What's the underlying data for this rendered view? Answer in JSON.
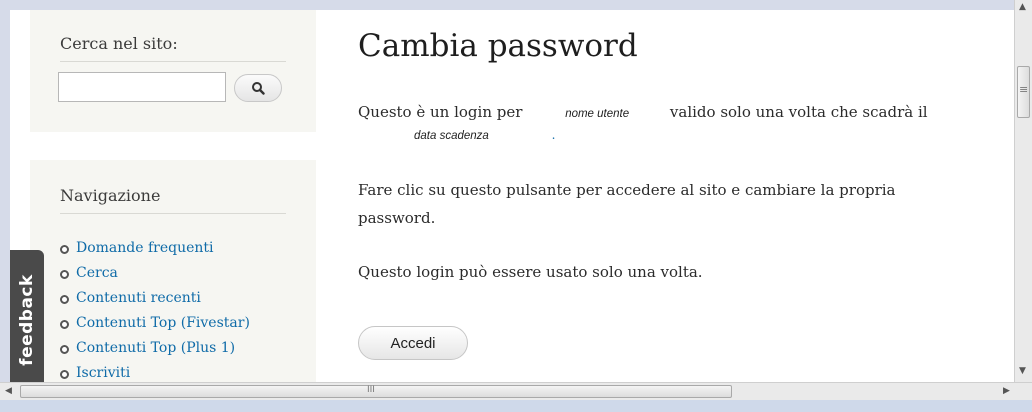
{
  "sidebar": {
    "search_title": "Cerca nel sito:",
    "search_input_value": "",
    "nav_title": "Navigazione",
    "nav_items": [
      {
        "label": "Domande frequenti"
      },
      {
        "label": "Cerca"
      },
      {
        "label": "Contenuti recenti"
      },
      {
        "label": "Contenuti Top (Fivestar)"
      },
      {
        "label": "Contenuti Top (Plus 1)"
      },
      {
        "label": "Iscriviti"
      }
    ],
    "feedback_label": "feedback"
  },
  "main": {
    "title": "Cambia password",
    "login_text_1": "Questo è un login per",
    "username_placeholder": "nome utente",
    "login_text_2": "valido solo una volta che scadrà il",
    "expiry_placeholder": "data scadenza",
    "trailing_dot": ".",
    "instruction": "Fare clic su questo pulsante per accedere al sito e cambiare la propria password.",
    "once_note": "Questo login può essere usato solo una volta.",
    "login_button": "Accedi"
  },
  "scroll": {
    "h_grip": "III",
    "v_grip": "≡"
  },
  "icons": {
    "search": "search-icon",
    "left_arrow": "left-arrow-icon",
    "right_arrow": "right-arrow-icon",
    "up_arrow": "up-arrow-icon",
    "down_arrow": "down-arrow-icon"
  },
  "colors": {
    "link": "#0f6ba8",
    "sidebar_bg": "#f6f6f2",
    "feedback_bg": "#4a4a4a"
  }
}
